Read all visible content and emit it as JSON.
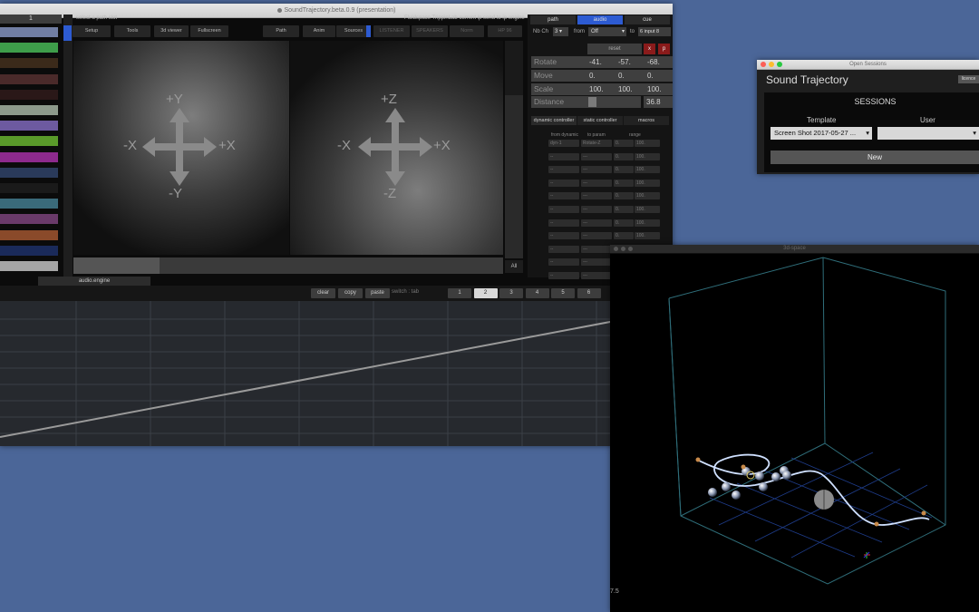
{
  "main_window": {
    "title": "SoundTrajectory.beta.0.9 (presentation)",
    "path_slot_number": "1",
    "hint": "select a path slot",
    "status": "Fluidspace TrippinLab current ip send to ip engine",
    "toolbar": [
      "Setup",
      "Tools",
      "3d viewer",
      "Fullscreen",
      "Path",
      "Anim",
      "Sources",
      "LISTENER",
      "SPEAKERS",
      "Norm",
      "HP 96"
    ],
    "xy_labels": {
      "up": "+Y",
      "down": "-Y",
      "left": "-X",
      "right": "+X"
    },
    "xz_labels": {
      "up": "+Z",
      "down": "-Z",
      "left": "-X",
      "right": "+X"
    },
    "all_label": "All",
    "swatch_colors": [
      "#717ea3",
      "#3e9d4a",
      "#3b2a1a",
      "#4a2a2a",
      "#2a1818",
      "#8d9a8c",
      "#6d5aa0",
      "#5a9a2a",
      "#8d2a8d",
      "#2a3a5a",
      "#1a1a1a",
      "#3a6a7a",
      "#6a3a6a",
      "#8a4a2a",
      "#1a2a5a",
      "#a6a6a6"
    ]
  },
  "right_panel": {
    "tabs": [
      "path",
      "audio",
      "cue"
    ],
    "nb_ch_label": "Nb Ch",
    "nb_ch_value": "3",
    "from_label": "from",
    "from_value": "Off",
    "to_label": "to",
    "to_value": "6 input 8",
    "reset_label": "reset",
    "x_btn": "x",
    "p_btn": "p",
    "transform_rows": [
      {
        "label": "Rotate",
        "v1": "-41.",
        "v2": "-57.",
        "v3": "-68."
      },
      {
        "label": "Move",
        "v1": "0.",
        "v2": "0.",
        "v3": "0."
      },
      {
        "label": "Scale",
        "v1": "100.",
        "v2": "100.",
        "v3": "100."
      }
    ],
    "distance_label": "Distance",
    "distance_value": "36.8",
    "controller_tabs": [
      "dynamic controller",
      "static controller",
      "macros"
    ],
    "mapping_headers": [
      "from dynamic",
      "to param",
      "range"
    ],
    "mapping_first": {
      "from": "dyn-1",
      "to": "Rotate-Z",
      "min": "0.",
      "max": "100."
    },
    "mapping_empty": {
      "from": "--",
      "to": "---",
      "min": "0.",
      "max": "100."
    }
  },
  "audio_section": {
    "tab_label": "audio.engine",
    "buttons": [
      "clear",
      "copy",
      "paste"
    ],
    "switch_label": "switch : tab",
    "slots": [
      "1",
      "2",
      "3",
      "4",
      "5",
      "6"
    ],
    "selected_slot": "2"
  },
  "sessions_window": {
    "title": "Open Sessions",
    "app_name": "Sound Trajectory",
    "license_btn": "licence",
    "heading": "SESSIONS",
    "template_label": "Template",
    "user_label": "User",
    "template_value": "Screen Shot 2017-05-27 ...",
    "new_button": "New"
  },
  "space_window": {
    "title": "3d-space",
    "corner_value": "7.5"
  }
}
